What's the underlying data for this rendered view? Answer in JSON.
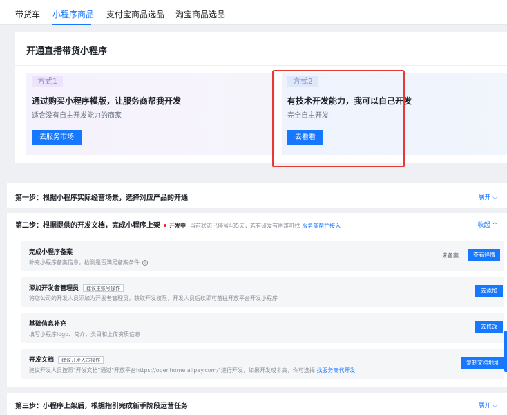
{
  "tabs": [
    {
      "label": "带货车"
    },
    {
      "label": "小程序商品"
    },
    {
      "label": "支付宝商品选品"
    },
    {
      "label": "淘宝商品选品"
    }
  ],
  "open_card": {
    "title": "开通直播带货小程序",
    "method1": {
      "badge": "方式1",
      "title": "通过购买小程序模版，让服务商帮我开发",
      "desc": "适合没有自主开发能力的商家",
      "button": "去服务市场"
    },
    "method2": {
      "badge": "方式2",
      "title": "有技术开发能力，我可以自己开发",
      "desc": "完全自主开发",
      "button": "去看看"
    }
  },
  "step1": {
    "title": "第一步：根据小程序实际经营场景，选择对应产品的开通",
    "toggle": "展开 ⌵"
  },
  "step2": {
    "title": "第二步：根据提供的开发文档，完成小程序上架",
    "status": "开发中",
    "status_note": "当前状态已停留485天，若有研发有困难可找",
    "status_link": "服务商帮忙接入",
    "toggle": "收起 ^",
    "items": [
      {
        "title": "完成小程序备案",
        "tag": "",
        "desc": "补充小程序备案信息，检测是否满足备案条件",
        "status": "未备案",
        "button": "查看详情"
      },
      {
        "title": "添加开发者管理员",
        "tag": "建议主账号操作",
        "desc": "将您公司的开发人员添加为开发者管理员，获取开发权限，开发人员后续即可前往开放平台开发小程序",
        "button": "去添加"
      },
      {
        "title": "基础信息补充",
        "tag": "",
        "desc": "填写小程序logo、简介，类目和上传资质信息",
        "button": "去修改"
      },
      {
        "title": "开发文档",
        "tag": "建议开发人员操作",
        "desc": "建议开发人员按照\"开发文档\"通过\"开放平台https://openhome.alipay.com/\"进行开发，如果开发成本高，你可选择",
        "desc_link": "找服务商代开发",
        "button": "复制文档地址"
      }
    ]
  },
  "step3": {
    "title": "第三步：小程序上架后，根据指引完成新手阶段运营任务",
    "toggle": "展开 ⌵"
  },
  "colors": {
    "primary": "#1677ff",
    "highlight": "#e53935",
    "status_dot": "#f5222d"
  }
}
